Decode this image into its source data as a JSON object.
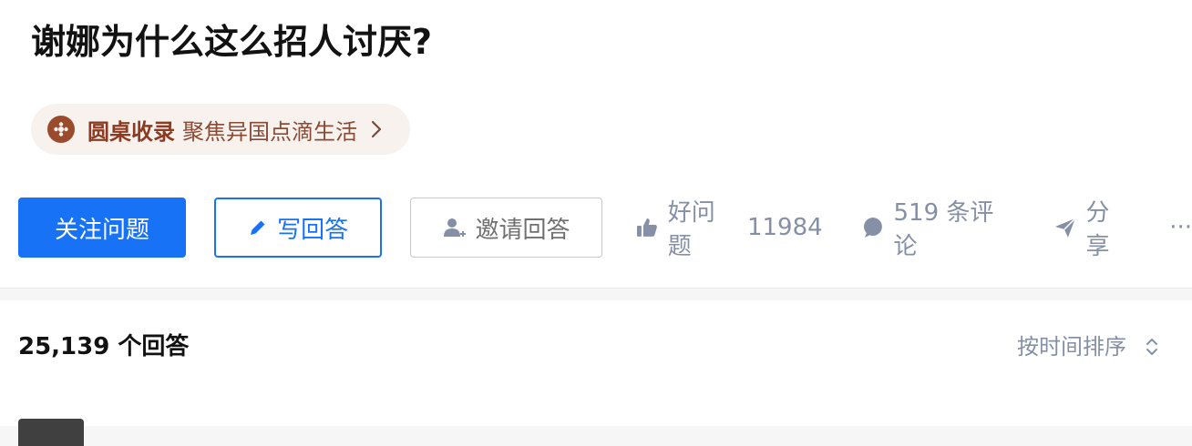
{
  "question": {
    "title": "谢娜为什么这么招人讨厌?"
  },
  "roundtable": {
    "name": "圆桌收录",
    "topic": "聚焦异国点滴生活",
    "icon": "roundtable-icon",
    "chevron_icon": "chevron-right-icon"
  },
  "actions": {
    "follow_label": "关注问题",
    "write_answer_label": "写回答",
    "invite_label": "邀请回答",
    "like_label": "好问题",
    "like_count": "11984",
    "comment_label": "519 条评论",
    "share_label": "分享",
    "more_label": "···"
  },
  "answers": {
    "count_label": "25,139 个回答",
    "sort_label": "按时间排序"
  },
  "colors": {
    "accent": "#1772f6",
    "roundtable_text": "#8c3b21",
    "roundtable_bg": "#f8f2ef",
    "meta_text": "#8590a6"
  }
}
